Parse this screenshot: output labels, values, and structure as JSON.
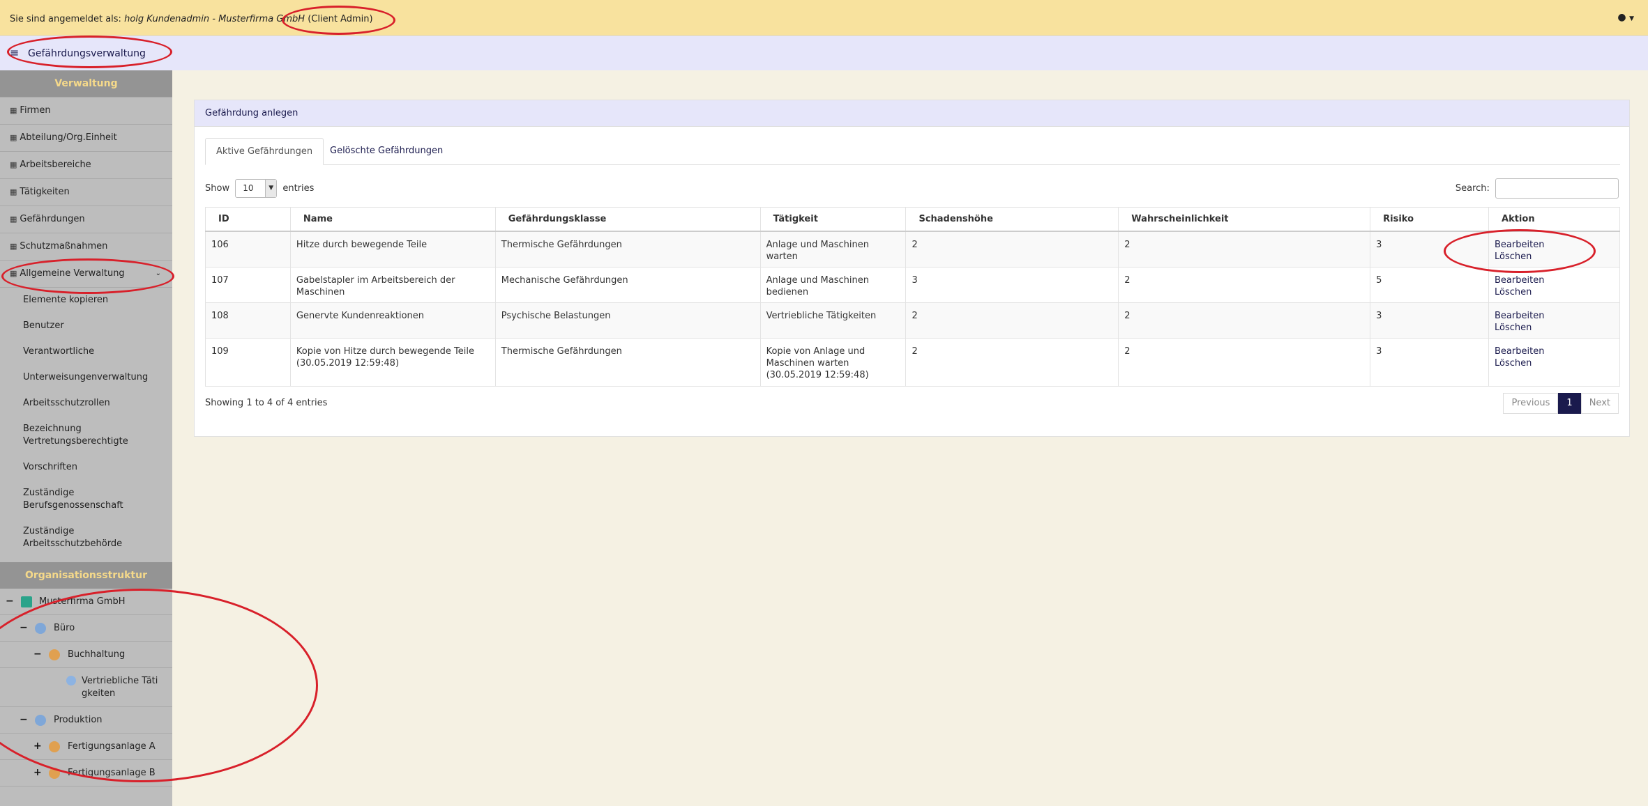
{
  "header": {
    "login_prefix": "Sie sind angemeldet als:",
    "login_user": "holg Kundenadmin - Musterfirma GmbH",
    "login_role": "(Client Admin)",
    "user_icon": "user-icon"
  },
  "app": {
    "title": "Gefährdungsverwaltung",
    "menu_icon": "hamburger-icon"
  },
  "sidebar": {
    "section1": "Verwaltung",
    "items": [
      {
        "label": "Firmen"
      },
      {
        "label": "Abteilung/Org.Einheit"
      },
      {
        "label": "Arbeitsbereiche"
      },
      {
        "label": "Tätigkeiten"
      },
      {
        "label": "Gefährdungen"
      },
      {
        "label": "Schutzmaßnahmen"
      },
      {
        "label": "Allgemeine Verwaltung"
      }
    ],
    "subitems": [
      {
        "label": "Elemente kopieren"
      },
      {
        "label": "Benutzer"
      },
      {
        "label": "Verantwortliche"
      },
      {
        "label": "Unterweisungenverwaltung"
      },
      {
        "label": "Arbeitsschutzrollen"
      },
      {
        "label": "Bezeichnung Vertretungsberechtigte"
      },
      {
        "label": "Vorschriften"
      },
      {
        "label": "Zuständige Berufsgenossenschaft"
      },
      {
        "label": "Zuständige Arbeitsschutzbehörde"
      }
    ],
    "section2": "Organisationsstruktur",
    "tree": [
      {
        "label": "Musterfirma GmbH",
        "toggle": "−"
      },
      {
        "label": "Büro",
        "toggle": "−"
      },
      {
        "label": "Buchhaltung",
        "toggle": "−"
      },
      {
        "label": "Vertriebliche Täti gkeiten",
        "toggle": ""
      },
      {
        "label": "Produktion",
        "toggle": "−"
      },
      {
        "label": "Fertigungsanlage A",
        "toggle": "+"
      },
      {
        "label": "Fertigungsanlage B",
        "toggle": "+"
      }
    ]
  },
  "panel": {
    "title": "Gefährdung anlegen",
    "tabs": [
      "Aktive Gefährdungen",
      "Gelöschte Gefährdungen"
    ],
    "show_label": "Show",
    "entries_value": "10",
    "entries_label": "entries",
    "search_label": "Search:",
    "search_value": "",
    "columns": [
      "ID",
      "Name",
      "Gefährdungsklasse",
      "Tätigkeit",
      "Schadenshöhe",
      "Wahrscheinlichkeit",
      "Risiko",
      "Aktion"
    ],
    "rows": [
      {
        "id": "106",
        "name": "Hitze durch bewegende Teile",
        "klasse": "Thermische Gefährdungen",
        "taetigkeit": "Anlage und Maschinen warten",
        "schaden": "2",
        "wahrsch": "2",
        "risiko": "3",
        "edit": "Bearbeiten",
        "del": "Löschen"
      },
      {
        "id": "107",
        "name": "Gabelstapler im Arbeitsbereich der Maschinen",
        "klasse": "Mechanische Gefährdungen",
        "taetigkeit": "Anlage und Maschinen bedienen",
        "schaden": "3",
        "wahrsch": "2",
        "risiko": "5",
        "edit": "Bearbeiten",
        "del": "Löschen"
      },
      {
        "id": "108",
        "name": "Genervte Kundenreaktionen",
        "klasse": "Psychische Belastungen",
        "taetigkeit": "Vertriebliche Tätigkeiten",
        "schaden": "2",
        "wahrsch": "2",
        "risiko": "3",
        "edit": "Bearbeiten",
        "del": "Löschen"
      },
      {
        "id": "109",
        "name": "Kopie von Hitze durch bewegende Teile (30.05.2019 12:59:48)",
        "klasse": "Thermische Gefährdungen",
        "taetigkeit": "Kopie von Anlage und Maschinen warten (30.05.2019 12:59:48)",
        "schaden": "2",
        "wahrsch": "2",
        "risiko": "3",
        "edit": "Bearbeiten",
        "del": "Löschen"
      }
    ],
    "info": "Showing 1 to 4 of 4 entries",
    "pager": {
      "prev": "Previous",
      "current": "1",
      "next": "Next"
    }
  },
  "annotation_color": "#d8202a"
}
